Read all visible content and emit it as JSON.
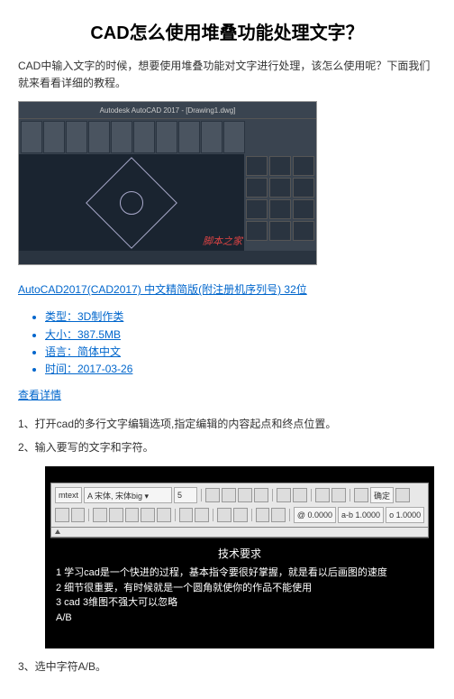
{
  "title": "CAD怎么使用堆叠功能处理文字？",
  "intro": "CAD中输入文字的时候，想要使用堆叠功能对文字进行处理，该怎么使用呢？下面我们就来看看详细的教程。",
  "screenshot1": {
    "app_title": "Autodesk AutoCAD 2017 - [Drawing1.dwg]",
    "watermark": "脚本之家"
  },
  "download_link": "AutoCAD2017(CAD2017) 中文精简版(附注册机序列号) 32位",
  "meta": [
    "类型：3D制作类",
    "大小：387.5MB",
    "语言：简体中文",
    "时间：2017-03-26"
  ],
  "detail_link": "查看详情",
  "steps": [
    "1、打开cad的多行文字编辑选项,指定编辑的内容起点和终点位置。",
    "2、输入要写的文字和字符。",
    "3、选中字符A/B。"
  ],
  "editor": {
    "style_label": "mtext",
    "font_label": "A 宋体, 宋体big ▾",
    "size_value": "5",
    "ok_button": "确定",
    "ratio_label": "@ 0.0000",
    "ab_label": "a-b 1.0000",
    "o_label": "o 1.0000",
    "content_title": "技术要求",
    "lines": [
      "1 学习cad是一个快进的过程，基本指令要很好掌握，就是看以后画图的速度",
      "2 细节很重要，有时候就是一个圆角就使你的作品不能使用",
      "3 cad 3维图不强大可以忽略",
      "A/B"
    ]
  }
}
